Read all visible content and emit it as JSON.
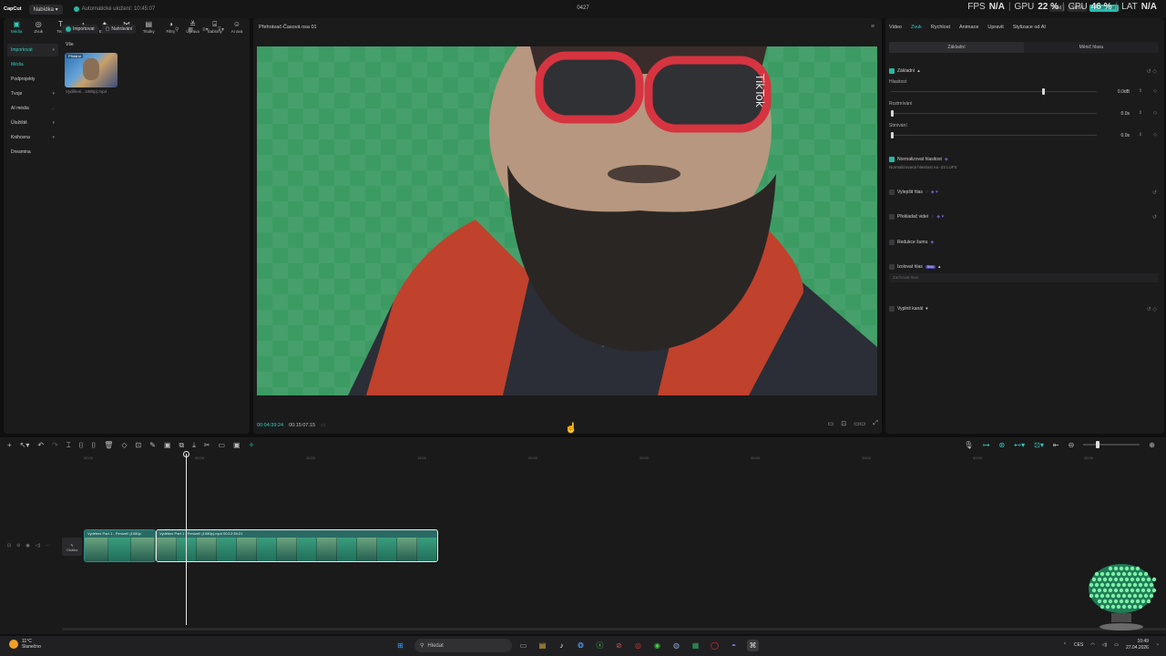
{
  "app": {
    "logo": "CapCut",
    "menu_label": "Nabídka",
    "autosave": "Automatické uložení: 10:45:07",
    "project_title": "0427",
    "top_buttons": [
      "Kód",
      "Sdílet",
      "Exportovat"
    ]
  },
  "hud": {
    "fps_label": "FPS",
    "fps_value": "N/A",
    "gpu_label": "GPU",
    "gpu_value": "22 %",
    "cpu_label": "CPU",
    "cpu_value": "46 %",
    "lat_label": "LAT",
    "lat_value": "N/A"
  },
  "toolbar": {
    "items": [
      {
        "label": "Média",
        "icon": "media-icon",
        "glyph": "▣"
      },
      {
        "label": "Zvuk",
        "icon": "audio-icon",
        "glyph": "◎"
      },
      {
        "label": "Text",
        "icon": "text-icon",
        "glyph": "T"
      },
      {
        "label": "Nálepky",
        "icon": "sticker-icon",
        "glyph": "◔"
      },
      {
        "label": "Efekty",
        "icon": "effects-icon",
        "glyph": "✦"
      },
      {
        "label": "Přechody",
        "icon": "transitions-icon",
        "glyph": "⋈"
      },
      {
        "label": "Titulky",
        "icon": "captions-icon",
        "glyph": "▤"
      },
      {
        "label": "Filtry",
        "icon": "filters-icon",
        "glyph": "◑"
      },
      {
        "label": "Úprava",
        "icon": "adjust-icon",
        "glyph": "≚"
      },
      {
        "label": "Šablony",
        "icon": "templates-icon",
        "glyph": "⌸"
      },
      {
        "label": "AI ava",
        "icon": "ai-avatar-icon",
        "glyph": "☺"
      }
    ]
  },
  "sidebar": {
    "items": [
      {
        "label": "Importovat",
        "chev": "▾"
      },
      {
        "label": "Média",
        "chev": ""
      },
      {
        "label": "Podprojekty",
        "chev": ""
      },
      {
        "label": "Tvoje",
        "chev": "▾"
      },
      {
        "label": "AI média",
        "chev": "→"
      },
      {
        "label": "Úložiště",
        "chev": "▾"
      },
      {
        "label": "Knihovna",
        "chev": "▾"
      },
      {
        "label": "Dreamina",
        "chev": ""
      }
    ]
  },
  "media": {
    "import_btn": "Importovat",
    "record_btn": "Nahrávání",
    "filter_label": "Vše",
    "thumb_tag": "Přidáno",
    "thumb_name": "Vydělení...1080p).mp4"
  },
  "player": {
    "title": "Přehrávač-Časová osa 01",
    "time_current": "00:04:39:24",
    "time_total": "00:15:07:15"
  },
  "right_panel": {
    "tabs": [
      "Video",
      "Zvuk",
      "Rychlost",
      "Animace",
      "Upravit",
      "Stylizace od AI"
    ],
    "active_tab": "Zvuk",
    "subtabs": [
      "Základní",
      "Měnič hlasu"
    ],
    "basic_title": "Základní",
    "sliders": [
      {
        "label": "Hlasitost",
        "value": "0.0dB",
        "pos": 0.74
      },
      {
        "label": "Roztmívání",
        "value": "0.0s",
        "pos": 0.0
      },
      {
        "label": "Stmívání",
        "value": "0.0s",
        "pos": 0.0
      }
    ],
    "normalize_title": "Normalizovat hlasitost",
    "normalize_note": "Normalizovaná hlasitost na -23 LUFS",
    "enhance_title": "Vylepšit hlas",
    "translate_title": "Překladač videí",
    "noise_title": "Redukce šumu",
    "isolate_title": "Izolovat hlas",
    "isolate_badge": "Beta",
    "isolate_dropdown": "Zachovat hlas",
    "fill_title": "Vyplnit kanál"
  },
  "timeline": {
    "ruler": [
      "00:00",
      "05:00",
      "10:00",
      "15:00",
      "20:00",
      "25:00",
      "30:00",
      "35:00",
      "40:00",
      "45:00"
    ],
    "cover_label": "Obálka",
    "clips": [
      {
        "label": "Vydělení Part 1 - Penízel! (1080p",
        "frames": 3
      },
      {
        "label": "Vydělení Part 1 - Penízel! (1080p).mp4  00:12:39:21",
        "frames": 14
      }
    ]
  },
  "taskbar": {
    "weather_temp": "11°C",
    "weather_text": "Slunečno",
    "search_placeholder": "Hledat",
    "lang": "CES",
    "time": "10:49",
    "date": "27.04.2026"
  },
  "colors": {
    "accent": "#2dd0bd",
    "panel": "#1b1b1c",
    "clip": "#2a6a64"
  }
}
